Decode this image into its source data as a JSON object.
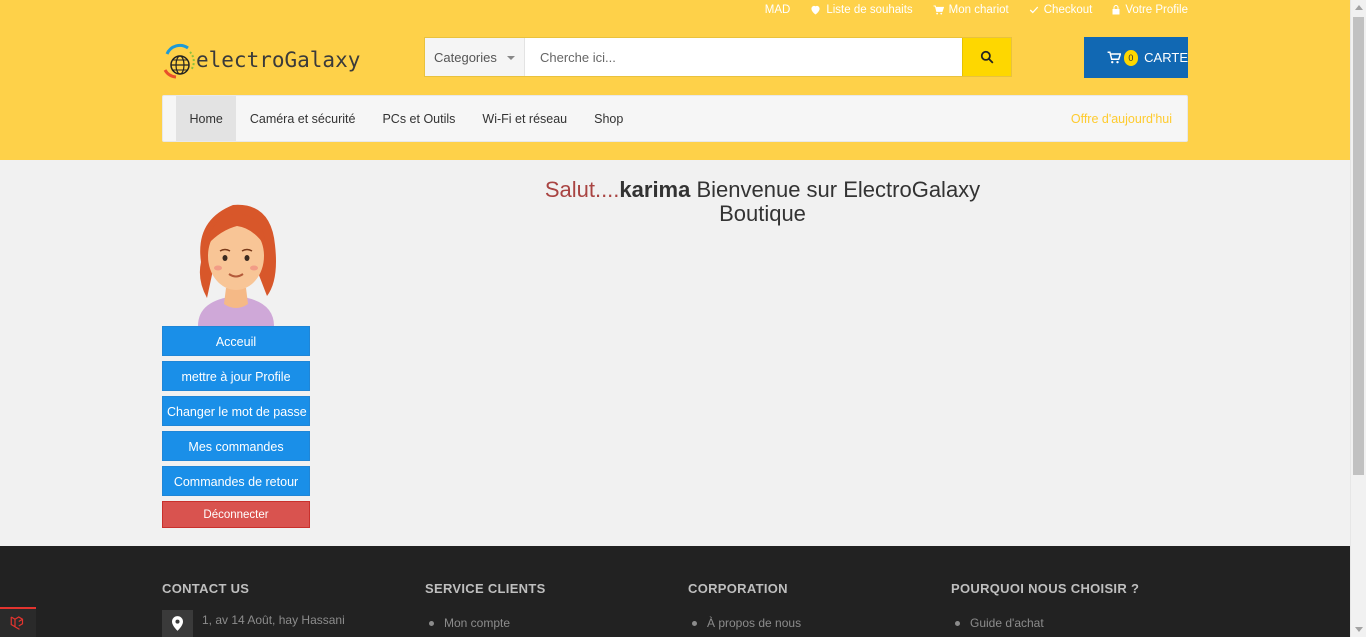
{
  "topbar": {
    "currency": "MAD",
    "wishlist": "Liste de souhaits",
    "cart": "Mon chariot",
    "checkout": "Checkout",
    "profile": "Votre Profile"
  },
  "logo": {
    "text": "electroGalaxy"
  },
  "search": {
    "category": "Categories",
    "placeholder": "Cherche ici..."
  },
  "cart": {
    "count": "0",
    "label": "CARTE"
  },
  "nav": {
    "items": [
      {
        "label": "Home"
      },
      {
        "label": "Caméra et sécurité"
      },
      {
        "label": "PCs et Outils"
      },
      {
        "label": "Wi-Fi et réseau"
      },
      {
        "label": "Shop"
      }
    ],
    "offer": "Offre d'aujourd'hui"
  },
  "welcome": {
    "salut": "Salut....",
    "user": "karima",
    "message": " Bienvenue sur ElectroGalaxy Boutique"
  },
  "sidebar": {
    "items": [
      {
        "label": "Acceuil"
      },
      {
        "label": "mettre à jour Profile"
      },
      {
        "label": "Changer le mot de passe"
      },
      {
        "label": "Mes commandes"
      },
      {
        "label": "Commandes de retour"
      }
    ],
    "logout": "Déconnecter"
  },
  "footer": {
    "contact": {
      "title": "CONTACT US",
      "address": "1, av 14 Août, hay Hassani"
    },
    "service": {
      "title": "SERVICE CLIENTS",
      "first": "Mon compte"
    },
    "corporation": {
      "title": "CORPORATION",
      "first": "À propos de nous"
    },
    "why": {
      "title": "POURQUOI NOUS CHOISIR ?",
      "first": "Guide d'achat"
    }
  },
  "colors": {
    "header": "#fed149",
    "primary_button": "#1a8fe8",
    "danger_button": "#d9534f",
    "cart": "#1168b3",
    "footer": "#222222"
  }
}
